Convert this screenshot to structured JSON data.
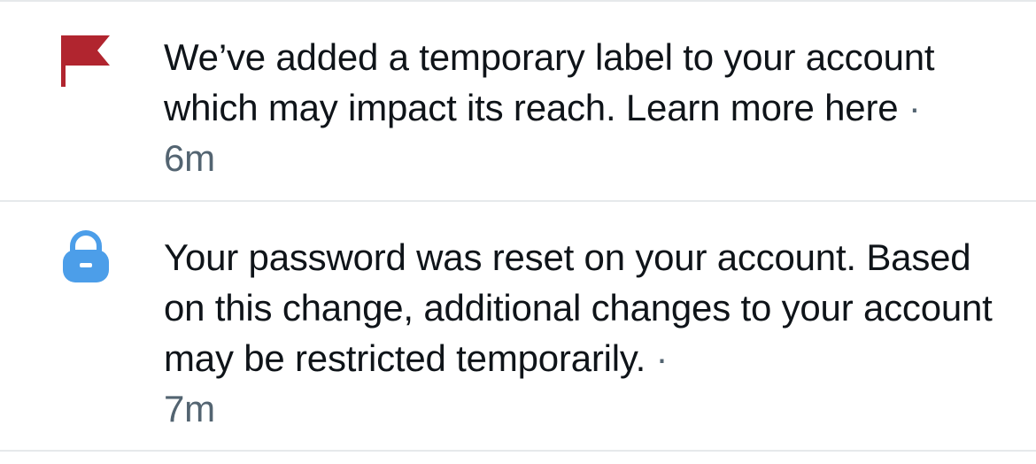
{
  "notifications": [
    {
      "icon": "flag-icon",
      "icon_color": "#b1252f",
      "text": "We’ve added a temporary label to your account which may impact its reach. Learn more here",
      "separator": "·",
      "time": "6m"
    },
    {
      "icon": "lock-icon",
      "icon_color": "#4c9ee9",
      "text": "Your password was reset on your account. Based on this change, additional changes to your account may be restricted temporarily.",
      "separator": "·",
      "time": "7m"
    }
  ],
  "colors": {
    "text_primary": "#0f1419",
    "text_secondary": "#536471",
    "divider": "#e6e9eb",
    "background": "#ffffff"
  }
}
